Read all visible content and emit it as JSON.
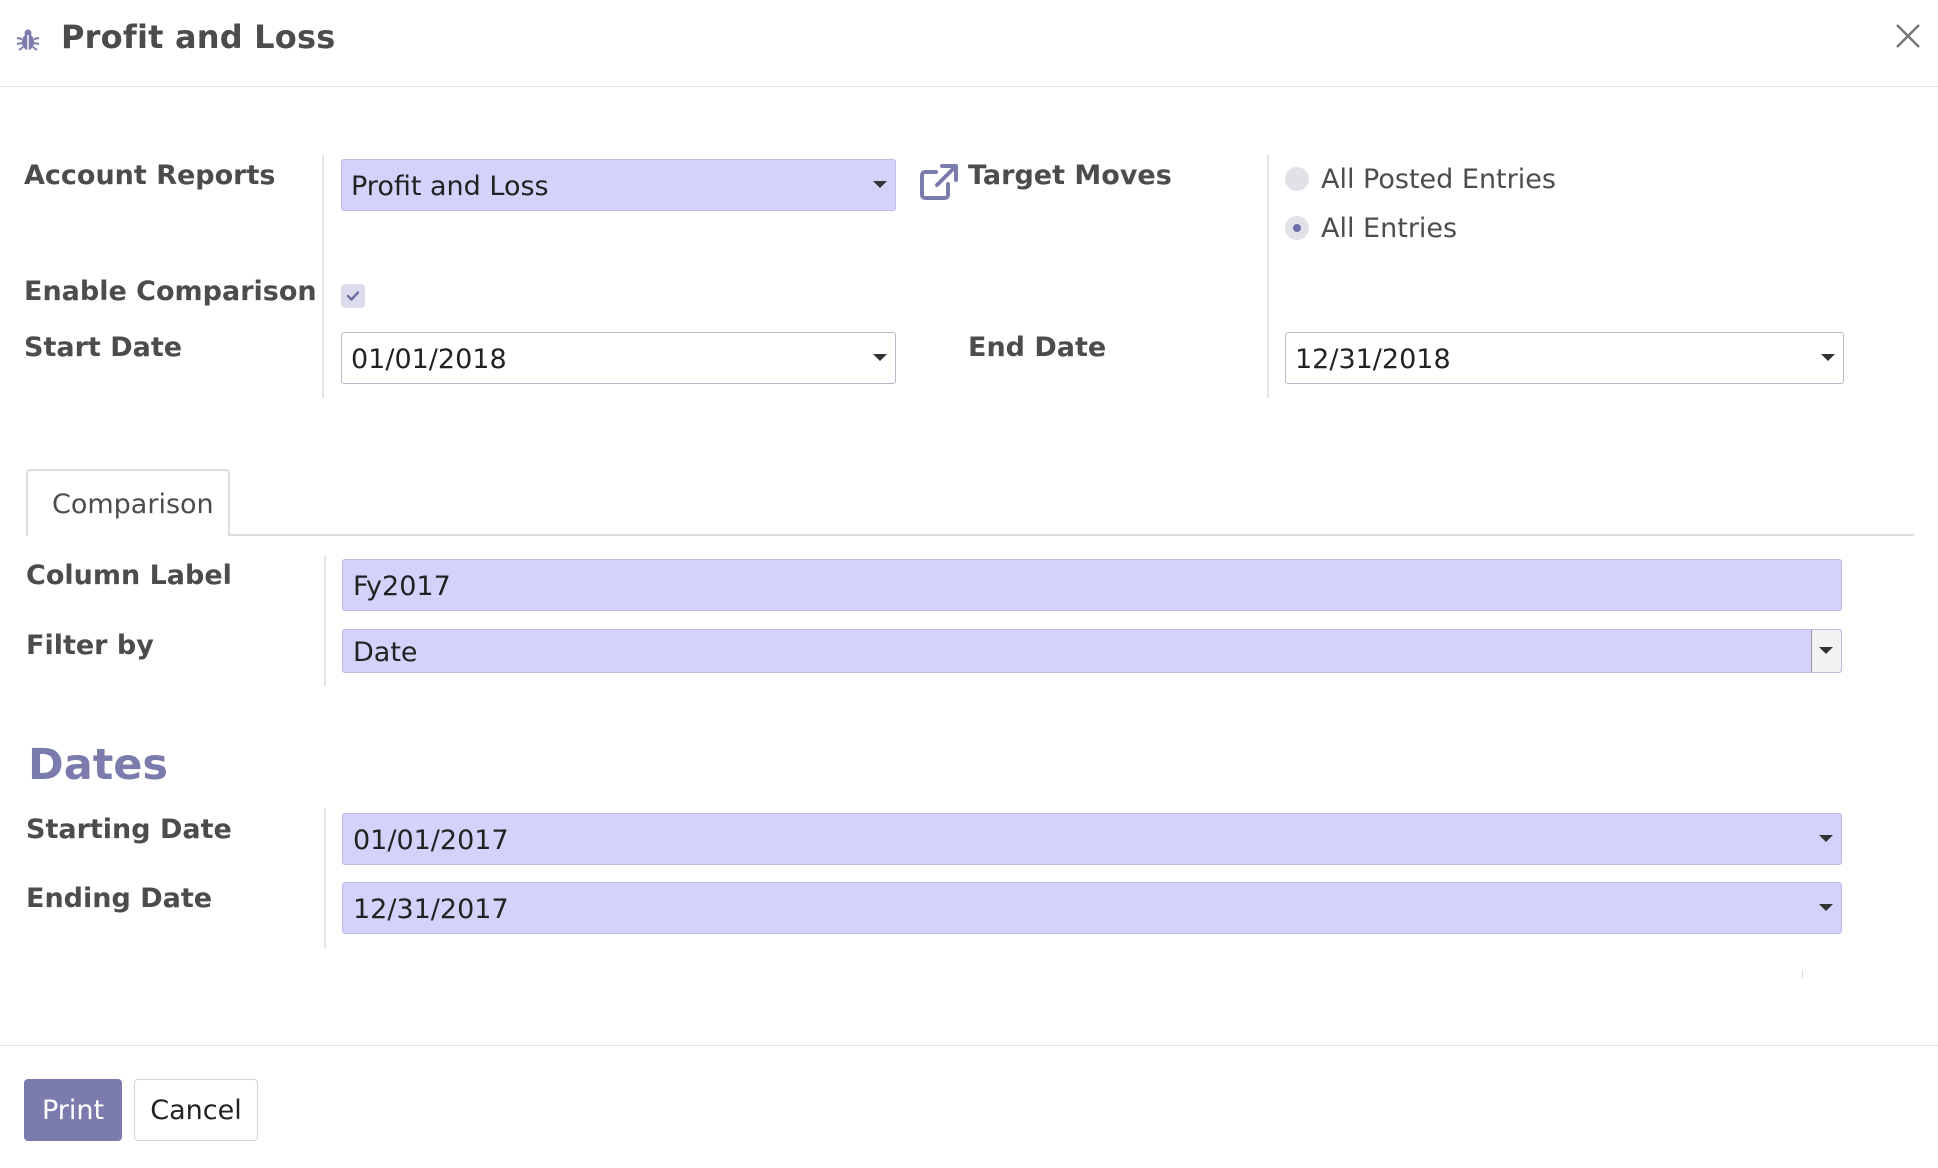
{
  "dialog": {
    "title": "Profit and Loss",
    "title_icon": "bug-icon",
    "close_icon": "close-icon"
  },
  "form": {
    "account_reports": {
      "label": "Account Reports",
      "value": "Profit and Loss"
    },
    "target_moves": {
      "label": "Target Moves",
      "options": [
        "All Posted Entries",
        "All Entries"
      ],
      "selected": "All Entries"
    },
    "enable_comparison": {
      "label": "Enable Comparison",
      "checked": true
    },
    "start_date": {
      "label": "Start Date",
      "value": "01/01/2018"
    },
    "end_date": {
      "label": "End Date",
      "value": "12/31/2018"
    }
  },
  "tabs": [
    {
      "label": "Comparison",
      "active": true
    }
  ],
  "comparison": {
    "column_label": {
      "label": "Column Label",
      "value": "Fy2017"
    },
    "filter_by": {
      "label": "Filter by",
      "value": "Date"
    },
    "dates_title": "Dates",
    "starting_date": {
      "label": "Starting Date",
      "value": "01/01/2017"
    },
    "ending_date": {
      "label": "Ending Date",
      "value": "12/31/2017"
    }
  },
  "footer": {
    "print_label": "Print",
    "cancel_label": "Cancel"
  },
  "colors": {
    "accent": "#7c7bad",
    "required_field_bg": "#d2d2fb",
    "text": "#4c4c4c"
  }
}
